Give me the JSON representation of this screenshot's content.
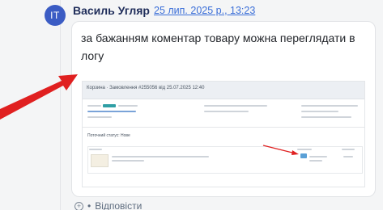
{
  "comment": {
    "avatar_initials": "IT",
    "author": "Василь Угляр",
    "date": "25 лип. 2025 р., 13:23",
    "text": "за бажанням коментар товару можна переглядати в логу"
  },
  "attachment": {
    "title": "Корзина · Замовлення #255056 від 25.07.2025 12:40",
    "section": "Поточний статус: Нове"
  },
  "actions": {
    "reply_label": "Відповісти"
  },
  "colors": {
    "avatar_bg": "#3b5cc4",
    "author": "#1f2d5a",
    "link": "#3a6ed8",
    "annotation_arrow": "#e02020"
  }
}
